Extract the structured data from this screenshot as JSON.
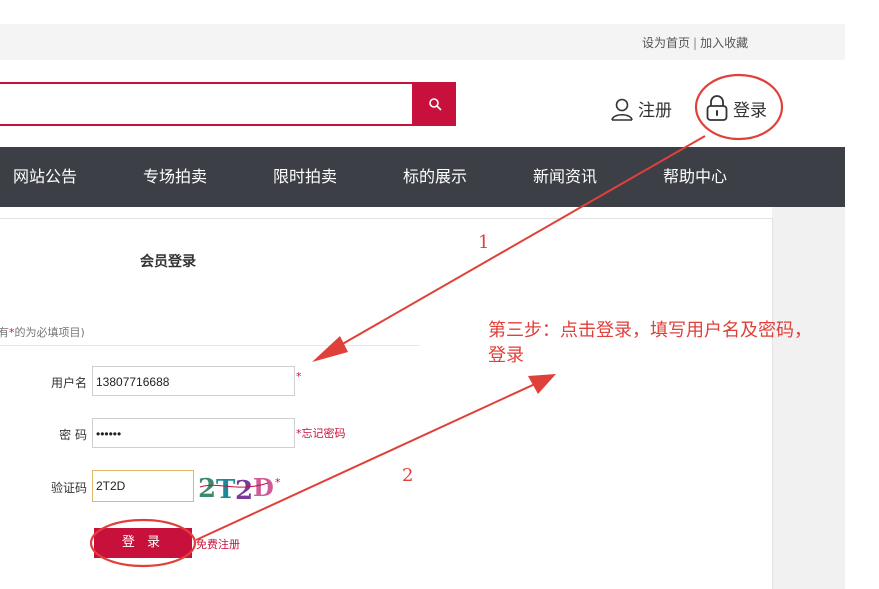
{
  "topbar": {
    "set_home": "设为首页",
    "separator": "|",
    "add_favorite": "加入收藏"
  },
  "header": {
    "search_value": "",
    "search_icon": "search-icon",
    "register_label": "注册",
    "login_label": "登录"
  },
  "nav": {
    "items": [
      {
        "label": "网站公告"
      },
      {
        "label": "专场拍卖"
      },
      {
        "label": "限时拍卖"
      },
      {
        "label": "标的展示"
      },
      {
        "label": "新闻资讯"
      },
      {
        "label": "帮助中心"
      }
    ]
  },
  "login_panel": {
    "title": "会员登录",
    "required_note_prefix": "有",
    "required_note_star": "*",
    "required_note_suffix": "的为必填项目)",
    "username_label": "用户名",
    "username_value": "13807716688",
    "username_star": "*",
    "password_label": "密 码",
    "password_value": "••••••",
    "forgot_password": "*忘记密码",
    "captcha_label": "验证码",
    "captcha_value": "2T2D",
    "captcha_image_text": "2T2D",
    "captcha_star": "*",
    "login_button": "登 录",
    "free_register": "免费注册"
  },
  "annotations": {
    "step_text": "第三步：点击登录，填写用户名及密码，登录",
    "label_1": "1",
    "label_2": "2",
    "color": "#e0403a"
  },
  "colors": {
    "brand": "#c8103c",
    "nav_bg": "#3c3f46",
    "annotation": "#e0403a"
  }
}
